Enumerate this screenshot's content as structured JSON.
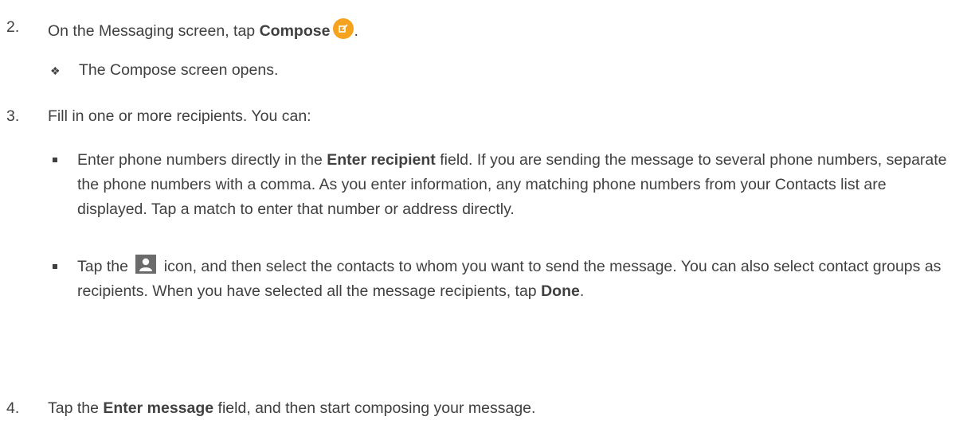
{
  "steps": [
    {
      "number": "2.",
      "prefix": "On the Messaging screen, tap ",
      "bold": "Compose",
      "suffix": ".",
      "icon": "compose-icon",
      "result": "The Compose screen opens."
    },
    {
      "number": "3.",
      "text": "Fill in one or more recipients. You can:",
      "bullets": [
        {
          "pre": "Enter phone numbers directly in the ",
          "bold": "Enter recipient",
          "post": " field. If you are sending the message to several phone numbers, separate the phone numbers with a comma. As you enter information, any matching phone numbers from your Contacts list are displayed. Tap a match to enter that number or address directly."
        },
        {
          "pre": "Tap the ",
          "icon": "contact-icon",
          "mid": " icon, and then select the contacts to whom you want to send the message. You can also select contact groups as recipients. When you have selected all the message recipients, tap ",
          "bold": "Done",
          "post": "."
        }
      ]
    },
    {
      "number": "4.",
      "prefix": "Tap the ",
      "bold": "Enter message",
      "suffix": " field, and then start composing your message."
    }
  ]
}
